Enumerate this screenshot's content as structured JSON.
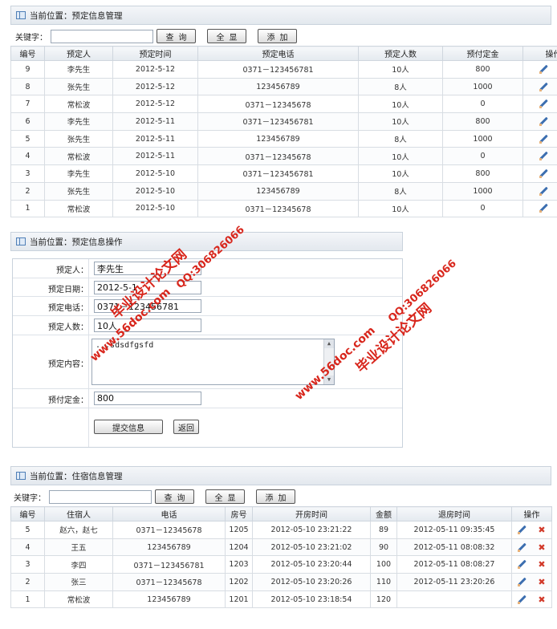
{
  "panel1": {
    "title": "当前位置：预定信息管理",
    "search": {
      "label": "关键字：",
      "value": "",
      "placeholder": ""
    },
    "buttons": {
      "query": "查询",
      "all": "全显",
      "add": "添加"
    },
    "columns": [
      "编号",
      "预定人",
      "预定时间",
      "预定电话",
      "预定人数",
      "预付定金",
      "操作"
    ],
    "rows": [
      [
        "9",
        "李先生",
        "2012-5-12",
        "0371－123456781",
        "10人",
        "800"
      ],
      [
        "8",
        "张先生",
        "2012-5-12",
        "123456789",
        "8人",
        "1000"
      ],
      [
        "7",
        "常松波",
        "2012-5-12",
        "0371－12345678",
        "10人",
        "0"
      ],
      [
        "6",
        "李先生",
        "2012-5-11",
        "0371－123456781",
        "10人",
        "800"
      ],
      [
        "5",
        "张先生",
        "2012-5-11",
        "123456789",
        "8人",
        "1000"
      ],
      [
        "4",
        "常松波",
        "2012-5-11",
        "0371－12345678",
        "10人",
        "0"
      ],
      [
        "3",
        "李先生",
        "2012-5-10",
        "0371－123456781",
        "10人",
        "800"
      ],
      [
        "2",
        "张先生",
        "2012-5-10",
        "123456789",
        "8人",
        "1000"
      ],
      [
        "1",
        "常松波",
        "2012-5-10",
        "0371－12345678",
        "10人",
        "0"
      ]
    ]
  },
  "panel2": {
    "title": "当前位置：预定信息操作",
    "fields": {
      "person": {
        "label": "预定人：",
        "value": "李先生"
      },
      "date": {
        "label": "预定日期：",
        "value": "2012-5-1"
      },
      "phone": {
        "label": "预定电话：",
        "value": "0371－123456781"
      },
      "count": {
        "label": "预定人数：",
        "value": "10人"
      },
      "content": {
        "label": "预定内容：",
        "value": "...sdsdfgsfd"
      },
      "deposit": {
        "label": "预付定金：",
        "value": "800"
      }
    },
    "buttons": {
      "submit": "提交信息",
      "back": "返回"
    }
  },
  "panel3": {
    "title": "当前位置：住宿信息管理",
    "search": {
      "label": "关键字：",
      "value": "",
      "placeholder": ""
    },
    "buttons": {
      "query": "查询",
      "all": "全显",
      "add": "添加"
    },
    "columns": [
      "编号",
      "住宿人",
      "电话",
      "房号",
      "开房时间",
      "金额",
      "退房时间",
      "操作"
    ],
    "rows": [
      [
        "5",
        "赵六，赵七",
        "0371－12345678",
        "1205",
        "2012-05-10 23:21:22",
        "89",
        "2012-05-11 09:35:45"
      ],
      [
        "4",
        "王五",
        "123456789",
        "1204",
        "2012-05-10 23:21:02",
        "90",
        "2012-05-11 08:08:32"
      ],
      [
        "3",
        "李四",
        "0371－123456781",
        "1203",
        "2012-05-10 23:20:44",
        "100",
        "2012-05-11 08:08:27"
      ],
      [
        "2",
        "张三",
        "0371－12345678",
        "1202",
        "2012-05-10 23:20:26",
        "110",
        "2012-05-11 23:20:26"
      ],
      [
        "1",
        "常松波",
        "123456789",
        "1201",
        "2012-05-10 23:18:54",
        "120",
        ""
      ]
    ]
  },
  "watermarks": {
    "site": "www.56doc.com",
    "qq": "QQ:306826066",
    "brand": "毕业设计论文网",
    "color": "#d8261c"
  }
}
